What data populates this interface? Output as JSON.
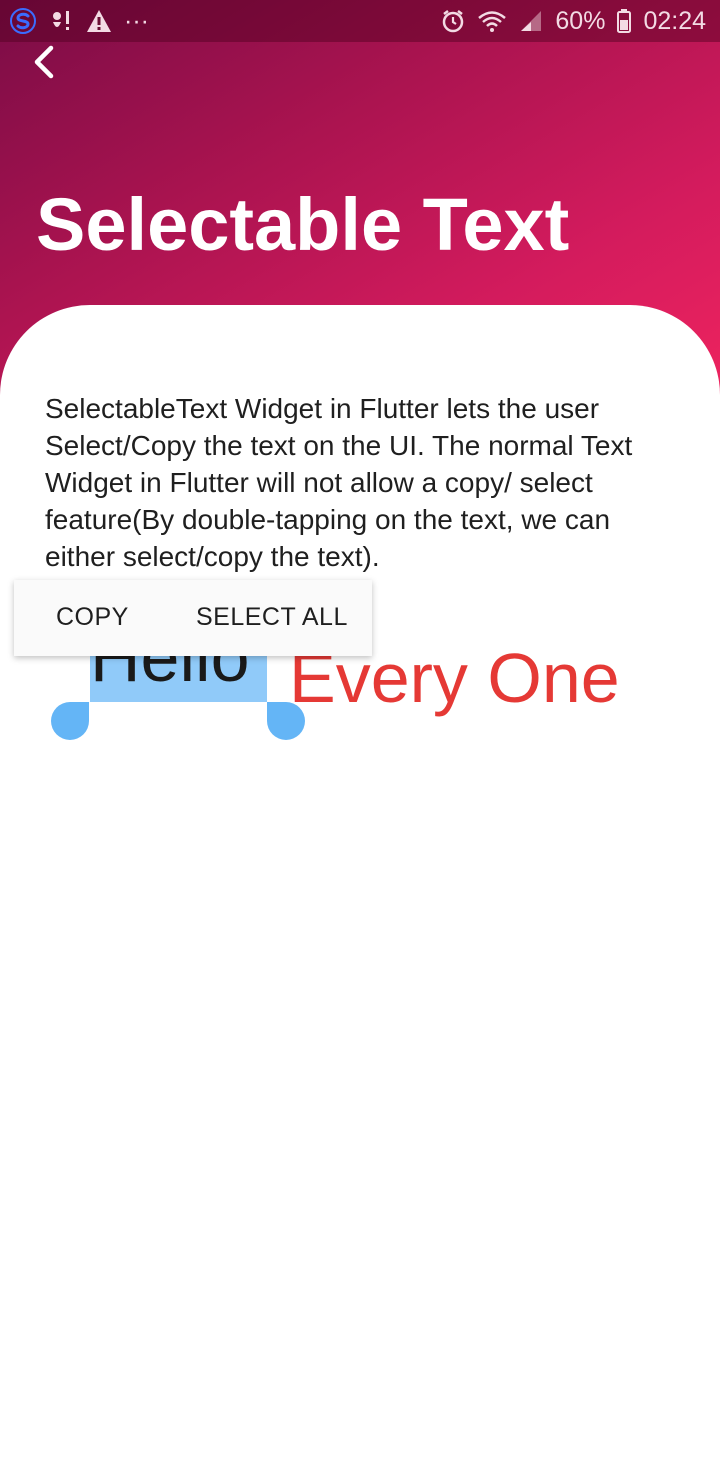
{
  "status_bar": {
    "battery_percent": "60%",
    "time": "02:24",
    "left_icons": [
      "s-app-icon",
      "notification-icon",
      "warning-icon",
      "more-notifications-icon"
    ],
    "right_icons": [
      "alarm-icon",
      "wifi-icon",
      "signal-icon",
      "battery-icon"
    ],
    "more_glyph": "···"
  },
  "header": {
    "back_icon": "back-arrow-icon",
    "title": "Selectable Text"
  },
  "content": {
    "description": "SelectableText Widget in Flutter lets the user Select/Copy the text on the UI. The normal Text Widget in Flutter will not allow a copy/ select feature(By double-tapping on the text, we can either select/copy the text).",
    "hello_selected": "Hello",
    "hello_rest": "Every One"
  },
  "context_menu": {
    "copy_label": "COPY",
    "select_all_label": "SELECT ALL"
  },
  "colors": {
    "gradient_start": "#7a0c46",
    "gradient_end": "#f0245f",
    "selection_highlight": "#90caf9",
    "selection_handle": "#64b5f6",
    "accent_text": "#e53935"
  }
}
